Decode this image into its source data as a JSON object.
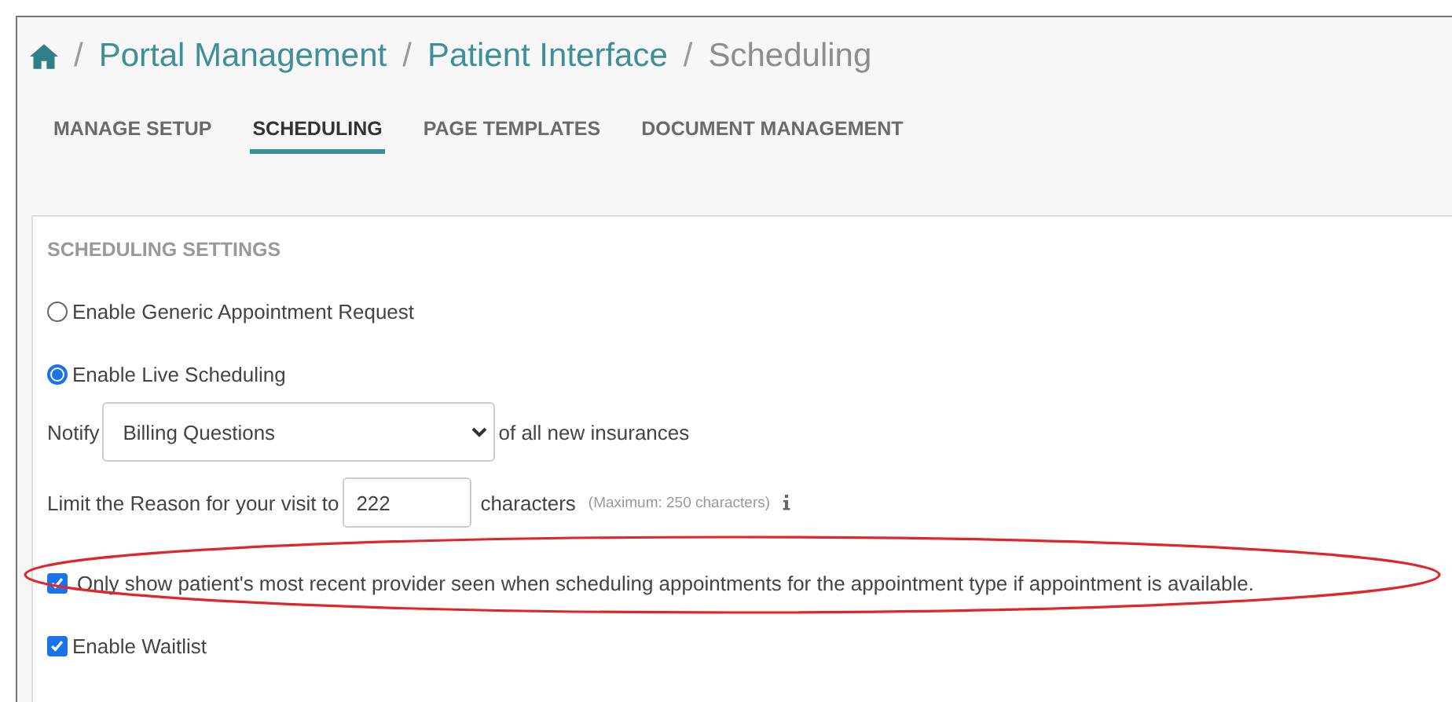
{
  "breadcrumb": {
    "items": [
      {
        "label": "Portal Management",
        "kind": "link"
      },
      {
        "label": "Patient Interface",
        "kind": "link"
      },
      {
        "label": "Scheduling",
        "kind": "current"
      }
    ],
    "separator": "/"
  },
  "tabs": [
    {
      "label": "MANAGE SETUP",
      "selected": false
    },
    {
      "label": "SCHEDULING",
      "selected": true
    },
    {
      "label": "PAGE TEMPLATES",
      "selected": false
    },
    {
      "label": "DOCUMENT MANAGEMENT",
      "selected": false
    }
  ],
  "section": {
    "title": "SCHEDULING SETTINGS",
    "settings": [
      {
        "kind": "radio",
        "label": "Enable Generic Appointment Request",
        "selected": false
      },
      {
        "kind": "radio",
        "label": "Enable Live Scheduling",
        "selected": true
      },
      {
        "kind": "select",
        "before": "Notify",
        "value": "Billing Questions",
        "after": "of all new insurances"
      },
      {
        "kind": "number",
        "before": "Limit the Reason for your visit to",
        "value": "222",
        "after": "characters",
        "hint": "(Maximum: 250 characters)"
      },
      {
        "kind": "checkbox",
        "label": "Only show patient's most recent provider seen when scheduling appointments for the appointment type if appointment is available.",
        "checked": true,
        "highlighted": true
      },
      {
        "kind": "checkbox",
        "label": "Enable Waitlist",
        "checked": true,
        "highlighted": false
      }
    ]
  }
}
